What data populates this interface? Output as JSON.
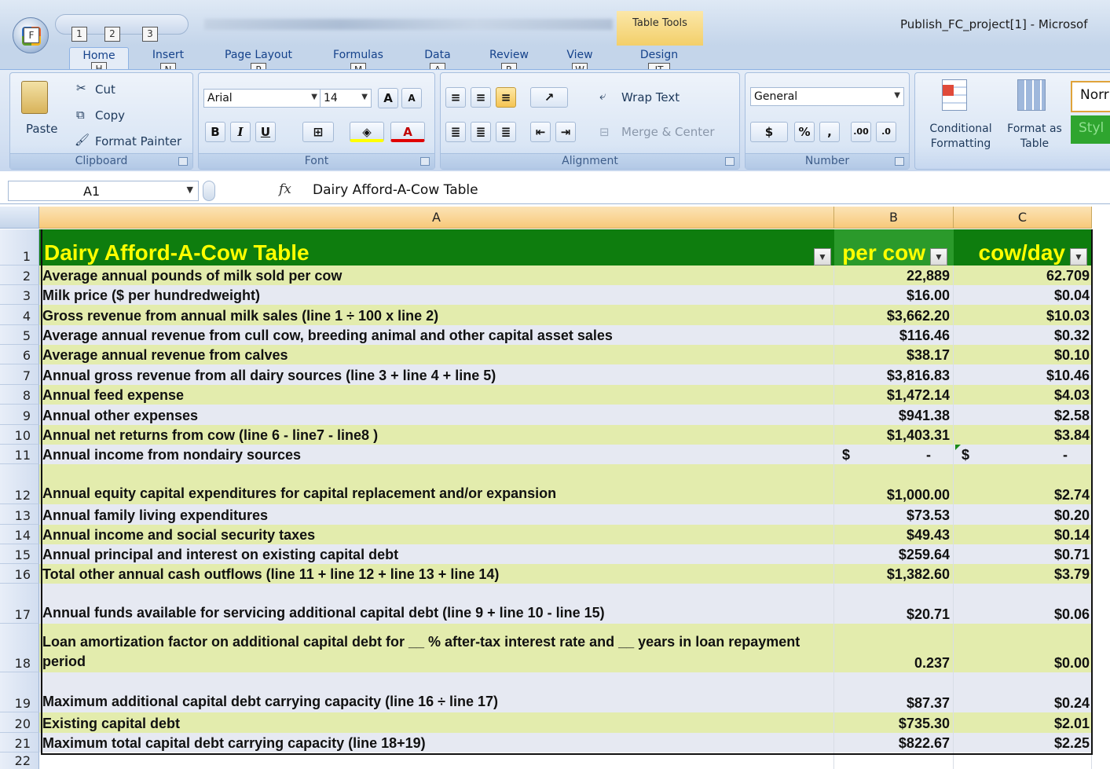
{
  "window": {
    "app_title": "Publish_FC_project[1] - Microsof",
    "context_tab_group": "Table Tools"
  },
  "keytips": {
    "office": "F",
    "qat": [
      "1",
      "2",
      "3"
    ]
  },
  "ribbon_tabs": [
    {
      "label": "Home",
      "keytip": "H"
    },
    {
      "label": "Insert",
      "keytip": "N"
    },
    {
      "label": "Page Layout",
      "keytip": "P"
    },
    {
      "label": "Formulas",
      "keytip": "M"
    },
    {
      "label": "Data",
      "keytip": "A"
    },
    {
      "label": "Review",
      "keytip": "R"
    },
    {
      "label": "View",
      "keytip": "W"
    },
    {
      "label": "Design",
      "keytip": "JT"
    }
  ],
  "ribbon": {
    "clipboard": {
      "label": "Clipboard",
      "paste": "Paste",
      "cut": "Cut",
      "copy": "Copy",
      "format_painter": "Format Painter"
    },
    "font": {
      "label": "Font",
      "name": "Arial",
      "size": "14",
      "bold": "B",
      "italic": "I",
      "underline": "U",
      "grow": "A",
      "shrink": "A",
      "color": "A"
    },
    "alignment": {
      "label": "Alignment",
      "wrap_text": "Wrap Text",
      "merge_center": "Merge & Center"
    },
    "number": {
      "label": "Number",
      "format": "General",
      "currency": "$",
      "percent": "%",
      "comma": ",",
      "inc_decimal": ".00",
      "dec_decimal": ".0"
    },
    "styles": {
      "conditional_formatting": "Conditional Formatting",
      "format_as_table": "Format as Table",
      "normal_preview": "Norr",
      "style_preview": "Styl"
    }
  },
  "formula_bar": {
    "name_box": "A1",
    "fx": "fx",
    "content": "Dairy Afford-A-Cow Table"
  },
  "columns": [
    "A",
    "B",
    "C"
  ],
  "table": {
    "title": "Dairy Afford-A-Cow Table",
    "col_b_header": "per cow",
    "col_c_header": "cow/day",
    "rows": [
      {
        "n": "2",
        "label": "Average annual pounds of milk sold per cow",
        "b": "22,889",
        "c": "62.709"
      },
      {
        "n": "3",
        "label": "Milk price ($ per hundredweight)",
        "b": "$16.00",
        "c": "$0.04"
      },
      {
        "n": "4",
        "label": "Gross revenue from annual milk sales (line 1 ÷ 100 x line 2)",
        "b": "$3,662.20",
        "c": "$10.03"
      },
      {
        "n": "5",
        "label": "Average annual revenue from cull cow, breeding animal and other capital asset sales",
        "b": "$116.46",
        "c": "$0.32"
      },
      {
        "n": "6",
        "label": "Average annual revenue from calves",
        "b": "$38.17",
        "c": "$0.10"
      },
      {
        "n": "7",
        "label": "Annual gross revenue from all dairy sources  (line 3 + line 4 + line 5)",
        "b": "$3,816.83",
        "c": "$10.46"
      },
      {
        "n": "8",
        "label": "Annual feed expense",
        "b": "$1,472.14",
        "c": "$4.03"
      },
      {
        "n": "9",
        "label": "Annual other expenses",
        "b": "$941.38",
        "c": "$2.58"
      },
      {
        "n": "10",
        "label": "Annual net returns from cow (line 6 - line7  - line8 )",
        "b": "$1,403.31",
        "c": "$3.84"
      },
      {
        "n": "11",
        "label": "Annual income from nondairy sources",
        "b": "-",
        "c": "-"
      },
      {
        "n": "12",
        "label": "Annual equity capital expenditures for capital replacement and/or expansion",
        "b": "$1,000.00",
        "c": "$2.74"
      },
      {
        "n": "13",
        "label": "Annual family living expenditures",
        "b": "$73.53",
        "c": "$0.20"
      },
      {
        "n": "14",
        "label": "Annual income and social security taxes",
        "b": "$49.43",
        "c": "$0.14"
      },
      {
        "n": "15",
        "label": "Annual principal and interest on existing capital debt",
        "b": "$259.64",
        "c": "$0.71"
      },
      {
        "n": "16",
        "label": "Total other annual cash outflows (line 11 + line 12 + line 13 + line 14)",
        "b": "$1,382.60",
        "c": "$3.79"
      },
      {
        "n": "17",
        "label": "Annual funds available for servicing additional capital debt (line 9 + line 10 - line 15)",
        "b": "$20.71",
        "c": "$0.06"
      },
      {
        "n": "18",
        "label": "Loan amortization factor on additional capital debt for __ % after-tax interest rate and __ years in loan repayment period",
        "b": "0.237",
        "c": "$0.00"
      },
      {
        "n": "19",
        "label": "Maximum additional capital debt carrying capacity (line 16 ÷ line 17)",
        "b": "$87.37",
        "c": "$0.24"
      },
      {
        "n": "20",
        "label": "Existing capital debt",
        "b": "$735.30",
        "c": "$2.01"
      },
      {
        "n": "21",
        "label": "Maximum total capital debt carrying capacity (line 18+19)",
        "b": "$822.67",
        "c": "$2.25"
      }
    ],
    "acct_symbol": "$",
    "last_row_num": "22"
  },
  "colors": {
    "header_green": "#0e7d0e",
    "header_yellow": "#ffff00",
    "band_yellow": "#e3ecad",
    "band_blue": "#e6e9f2"
  }
}
